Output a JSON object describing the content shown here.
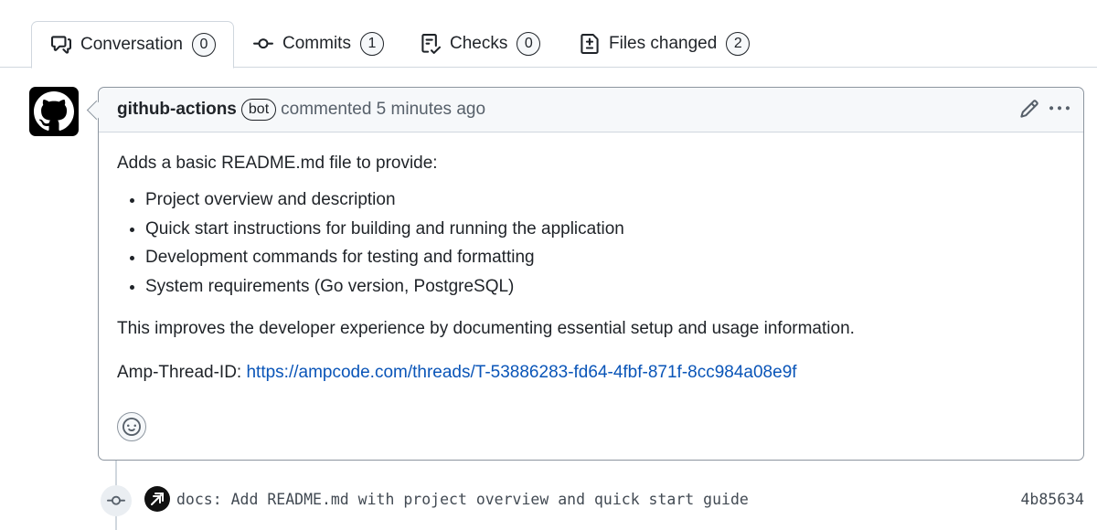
{
  "tabs": [
    {
      "label": "Conversation",
      "count": "0",
      "icon": "conversation-icon",
      "active": true
    },
    {
      "label": "Commits",
      "count": "1",
      "icon": "commit-icon",
      "active": false
    },
    {
      "label": "Checks",
      "count": "0",
      "icon": "checklist-icon",
      "active": false
    },
    {
      "label": "Files changed",
      "count": "2",
      "icon": "file-diff-icon",
      "active": false
    }
  ],
  "comment": {
    "author": "github-actions",
    "badge": "bot",
    "action": "commented 5 minutes ago",
    "intro": "Adds a basic README.md file to provide:",
    "items": [
      "Project overview and description",
      "Quick start instructions for building and running the application",
      "Development commands for testing and formatting",
      "System requirements (Go version, PostgreSQL)"
    ],
    "summary": "This improves the developer experience by documenting essential setup and usage information.",
    "thread_label": "Amp-Thread-ID: ",
    "thread_url": "https://ampcode.com/threads/T-53886283-fd64-4fbf-871f-8cc984a08e9f"
  },
  "commit": {
    "message": "docs: Add README.md with project overview and quick start guide",
    "sha": "4b85634"
  },
  "colors": {
    "link": "#0a55b8",
    "border": "#d0d7de",
    "header_bg": "#f6f8fa"
  }
}
